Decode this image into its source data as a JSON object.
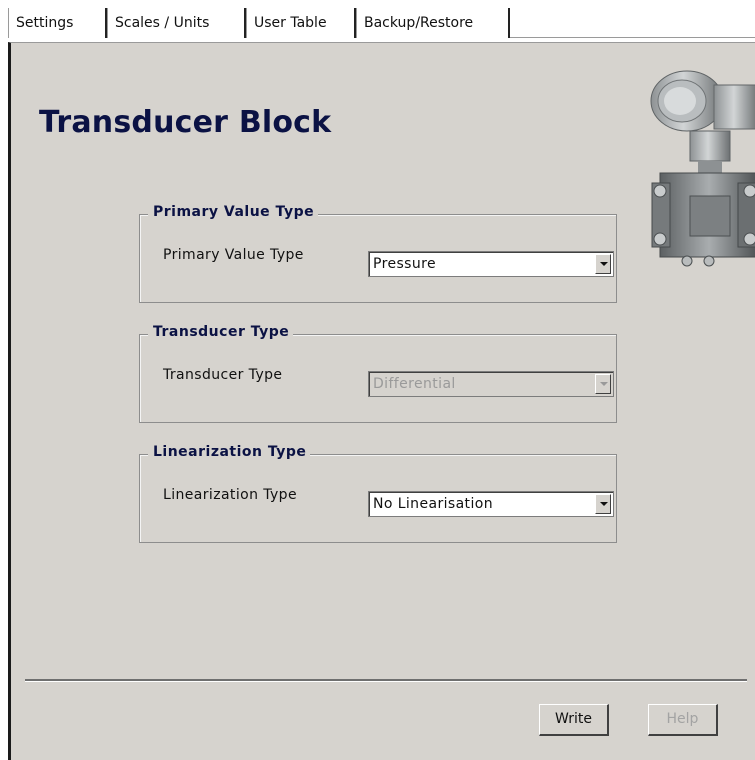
{
  "tabs": [
    {
      "label": "Settings",
      "active": true
    },
    {
      "label": "Scales / Units",
      "active": false
    },
    {
      "label": "User Table",
      "active": false
    },
    {
      "label": "Backup/Restore",
      "active": false
    }
  ],
  "page_title": "Transducer Block",
  "device_image": "pressure-transmitter-image",
  "groups": {
    "primary_value": {
      "legend": "Primary Value Type",
      "label": "Primary Value Type",
      "value": "Pressure",
      "enabled": true
    },
    "transducer": {
      "legend": "Transducer Type",
      "label": "Transducer Type",
      "value": "Differential",
      "enabled": false
    },
    "linearization": {
      "legend": "Linearization Type",
      "label": "Linearization Type",
      "value": "No Linearisation",
      "enabled": true
    }
  },
  "buttons": {
    "write": {
      "label": "Write",
      "enabled": true
    },
    "help": {
      "label": "Help",
      "enabled": false
    }
  },
  "colors": {
    "panel_bg": "#d6d3ce",
    "title": "#0b1244"
  }
}
